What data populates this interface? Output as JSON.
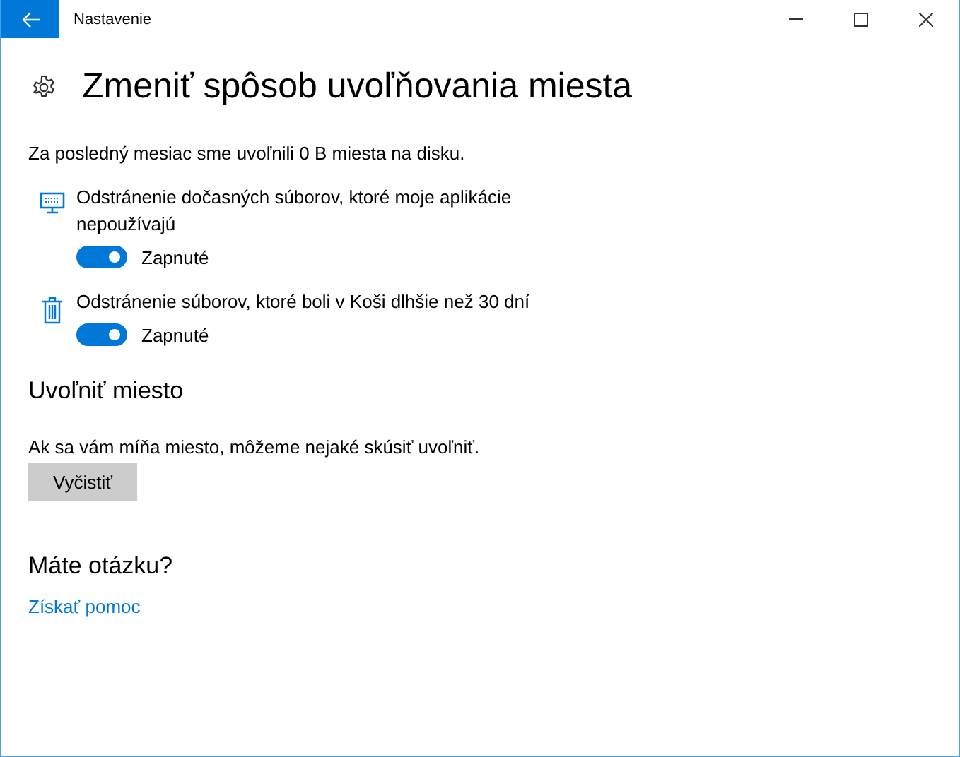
{
  "window": {
    "title": "Nastavenie"
  },
  "heading": "Zmeniť spôsob uvoľňovania miesta",
  "summary": "Za posledný mesiac sme uvoľnili 0 B miesta na disku.",
  "options": [
    {
      "kind": "monitor",
      "label": "Odstránenie dočasných súborov, ktoré moje aplikácie nepoužívajú",
      "on": true,
      "state_label": "Zapnuté"
    },
    {
      "kind": "trash",
      "label": "Odstránenie súborov, ktoré boli v Koši dlhšie než 30 dní",
      "on": true,
      "state_label": "Zapnuté"
    }
  ],
  "free_space": {
    "title": "Uvoľniť miesto",
    "text": "Ak sa vám míňa miesto, môžeme nejaké skúsiť uvoľniť.",
    "button": "Vyčistiť"
  },
  "help": {
    "title": "Máte otázku?",
    "link": "Získať pomoc"
  }
}
